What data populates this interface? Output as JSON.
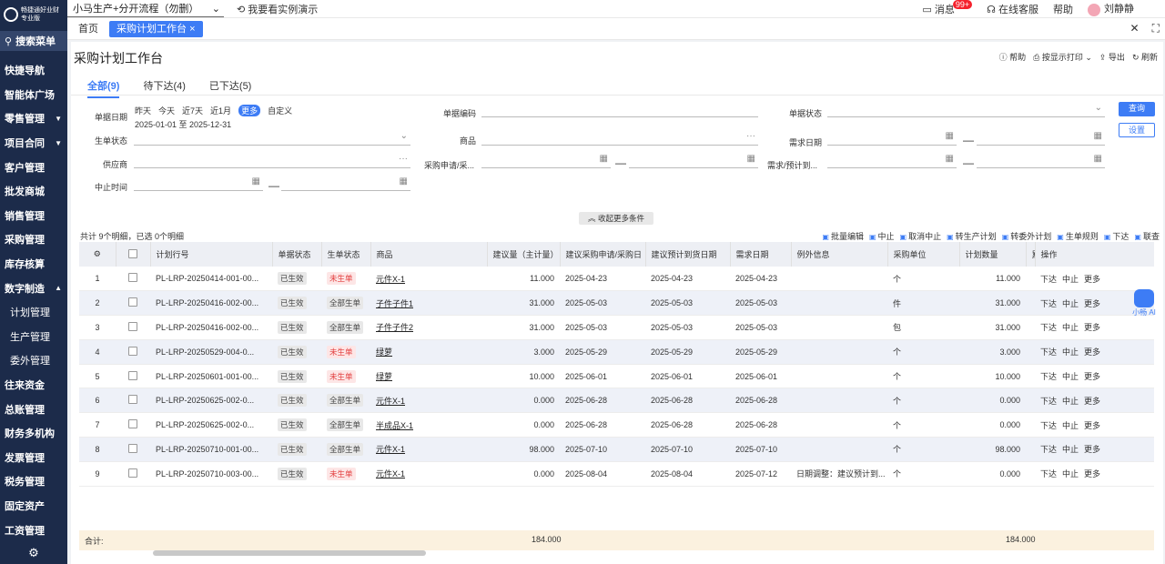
{
  "sidebar": {
    "brand": "畅捷通好业财",
    "edition": "专业版",
    "search": "搜索菜单",
    "items": [
      {
        "label": "快捷导航",
        "caret": ""
      },
      {
        "label": "智能体广场",
        "caret": ""
      },
      {
        "label": "零售管理",
        "caret": "▼"
      },
      {
        "label": "项目合同",
        "caret": "▼"
      },
      {
        "label": "客户管理",
        "caret": ""
      },
      {
        "label": "批发商城",
        "caret": ""
      },
      {
        "label": "销售管理",
        "caret": ""
      },
      {
        "label": "采购管理",
        "caret": ""
      },
      {
        "label": "库存核算",
        "caret": ""
      },
      {
        "label": "数字制造",
        "caret": "▲"
      },
      {
        "label": "计划管理",
        "caret": "",
        "sub": true
      },
      {
        "label": "生产管理",
        "caret": "",
        "sub": true
      },
      {
        "label": "委外管理",
        "caret": "",
        "sub": true
      },
      {
        "label": "往来资金",
        "caret": ""
      },
      {
        "label": "总账管理",
        "caret": ""
      },
      {
        "label": "财务多机构",
        "caret": ""
      },
      {
        "label": "发票管理",
        "caret": ""
      },
      {
        "label": "税务管理",
        "caret": ""
      },
      {
        "label": "固定资产",
        "caret": ""
      },
      {
        "label": "工资管理",
        "caret": ""
      }
    ]
  },
  "topbar": {
    "process": "小马生产+分开流程（勿删）",
    "demo": "我要看实例演示",
    "messages": "消息",
    "msg_badge": "99+",
    "service": "在线客服",
    "help": "帮助",
    "user": "刘静静"
  },
  "tabs": {
    "home": "首页",
    "active": "采购计划工作台"
  },
  "page": {
    "title": "采购计划工作台",
    "actions": [
      "帮助",
      "按显示打印",
      "导出",
      "刷新"
    ],
    "status_tabs": [
      "全部(9)",
      "待下达(4)",
      "已下达(5)"
    ]
  },
  "filters": {
    "date_label": "单据日期",
    "quick": [
      "昨天",
      "今天",
      "近7天",
      "近1月",
      "更多",
      "自定义"
    ],
    "date_range": "2025-01-01 至 2025-12-31",
    "doc_code": "单据编码",
    "doc_status": "单据状态",
    "gen_status": "生单状态",
    "goods": "商品",
    "need_date": "需求日期",
    "supplier": "供应商",
    "purchase_req": "采购申请/采...",
    "need_plan": "需求/预计到...",
    "stop_time": "中止时间",
    "dash": "—",
    "query": "查询",
    "settings": "设置",
    "collapse": "收起更多条件"
  },
  "table": {
    "count": "共计 9个明细，已选 0个明细",
    "toolbar": [
      "批量编辑",
      "中止",
      "取消中止",
      "转生产计划",
      "转委外计划",
      "生单规则",
      "下达",
      "联查"
    ],
    "columns": [
      "计划行号",
      "单据状态",
      "生单状态",
      "商品",
      "建议量（主计量）",
      "建议采购申请/采购日",
      "建议预计到货日期",
      "需求日期",
      "例外信息",
      "采购单位",
      "计划数量",
      "累",
      "操作"
    ],
    "ops": [
      "下达",
      "中止",
      "更多"
    ],
    "rows": [
      {
        "no": "1",
        "code": "PL-LRP-20250414-001-00...",
        "doc": "已生效",
        "gen": "未生单",
        "goods": "元件X-1",
        "qty": "11.000",
        "req": "2025-04-23",
        "arr": "2025-04-23",
        "need": "2025-04-23",
        "exc": "",
        "unit": "个",
        "plan": "11.000"
      },
      {
        "no": "2",
        "code": "PL-LRP-20250416-002-00...",
        "doc": "已生效",
        "gen": "全部生单",
        "goods": "子件子件1",
        "qty": "31.000",
        "req": "2025-05-03",
        "arr": "2025-05-03",
        "need": "2025-05-03",
        "exc": "",
        "unit": "件",
        "plan": "31.000"
      },
      {
        "no": "3",
        "code": "PL-LRP-20250416-002-00...",
        "doc": "已生效",
        "gen": "全部生单",
        "goods": "子件子件2",
        "qty": "31.000",
        "req": "2025-05-03",
        "arr": "2025-05-03",
        "need": "2025-05-03",
        "exc": "",
        "unit": "包",
        "plan": "31.000"
      },
      {
        "no": "4",
        "code": "PL-LRP-20250529-004-0...",
        "doc": "已生效",
        "gen": "未生单",
        "goods": "绿萝",
        "qty": "3.000",
        "req": "2025-05-29",
        "arr": "2025-05-29",
        "need": "2025-05-29",
        "exc": "",
        "unit": "个",
        "plan": "3.000"
      },
      {
        "no": "5",
        "code": "PL-LRP-20250601-001-00...",
        "doc": "已生效",
        "gen": "未生单",
        "goods": "绿萝",
        "qty": "10.000",
        "req": "2025-06-01",
        "arr": "2025-06-01",
        "need": "2025-06-01",
        "exc": "",
        "unit": "个",
        "plan": "10.000"
      },
      {
        "no": "6",
        "code": "PL-LRP-20250625-002-0...",
        "doc": "已生效",
        "gen": "全部生单",
        "goods": "元件X-1",
        "qty": "0.000",
        "req": "2025-06-28",
        "arr": "2025-06-28",
        "need": "2025-06-28",
        "exc": "",
        "unit": "个",
        "plan": "0.000"
      },
      {
        "no": "7",
        "code": "PL-LRP-20250625-002-0...",
        "doc": "已生效",
        "gen": "全部生单",
        "goods": "半成品X-1",
        "qty": "0.000",
        "req": "2025-06-28",
        "arr": "2025-06-28",
        "need": "2025-06-28",
        "exc": "",
        "unit": "个",
        "plan": "0.000"
      },
      {
        "no": "8",
        "code": "PL-LRP-20250710-001-00...",
        "doc": "已生效",
        "gen": "全部生单",
        "goods": "元件X-1",
        "qty": "98.000",
        "req": "2025-07-10",
        "arr": "2025-07-10",
        "need": "2025-07-10",
        "exc": "",
        "unit": "个",
        "plan": "98.000"
      },
      {
        "no": "9",
        "code": "PL-LRP-20250710-003-00...",
        "doc": "已生效",
        "gen": "未生单",
        "goods": "元件X-1",
        "qty": "0.000",
        "req": "2025-08-04",
        "arr": "2025-08-04",
        "need": "2025-07-12",
        "exc": "日期调整：建议预计到...",
        "unit": "个",
        "plan": "0.000"
      }
    ],
    "sum_label": "合计:",
    "sum_qty": "184.000",
    "sum_plan": "184.000"
  },
  "bot": "小畅 AI"
}
